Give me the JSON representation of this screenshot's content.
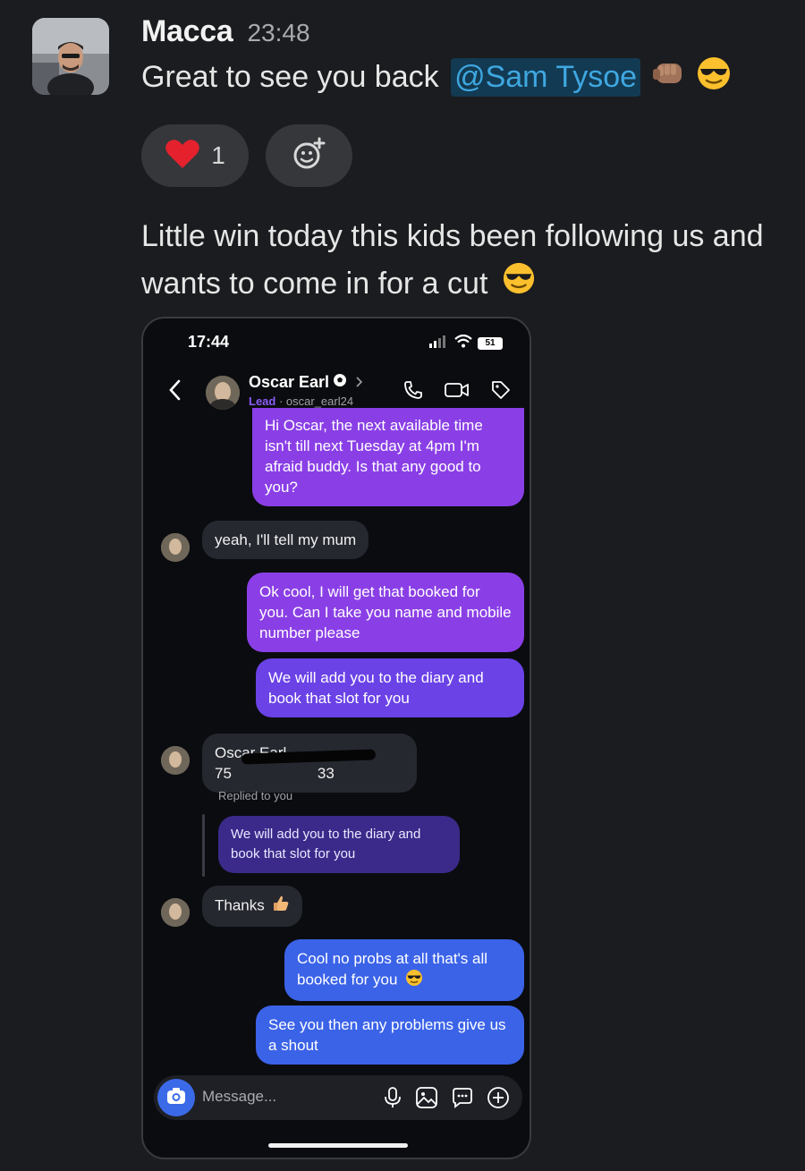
{
  "message": {
    "author": "Macca",
    "time": "23:48",
    "line1_prefix": "Great to see you back ",
    "mention": "@Sam Tysoe",
    "reactions": [
      {
        "icon": "heart-icon",
        "count": "1"
      }
    ],
    "add_reaction_icon": "add-reaction-icon",
    "body": "Little win today this kids been following us and wants to come in for a cut"
  },
  "phone": {
    "status_time": "17:44",
    "battery": "51",
    "contact_name": "Oscar Earl",
    "contact_lead": "Lead",
    "contact_handle": "· oscar_earl24",
    "messages": [
      {
        "from": "me",
        "text": "Hi Oscar, the next available time isn't till next Tuesday at 4pm I'm afraid buddy. Is that any good to you?"
      },
      {
        "from": "them",
        "text": "yeah, I'll tell my mum"
      },
      {
        "from": "me",
        "text": "Ok cool, I will get that booked for you. Can I take you name and mobile number please"
      },
      {
        "from": "me",
        "text": "We will add you to the diary and book that slot for you"
      },
      {
        "from": "them",
        "text": "Oscar Earl, 75"
      },
      {
        "from": "them",
        "text": "33"
      },
      {
        "from": "them",
        "text": "Thanks"
      },
      {
        "from": "me",
        "text": "Cool no probs at all that's all booked for you"
      },
      {
        "from": "me",
        "text": "See you then any problems give us a shout"
      }
    ],
    "replied_label": "Replied to you",
    "reply_quote": "We will add you to the diary and book that slot for you",
    "composer_placeholder": "Message..."
  }
}
